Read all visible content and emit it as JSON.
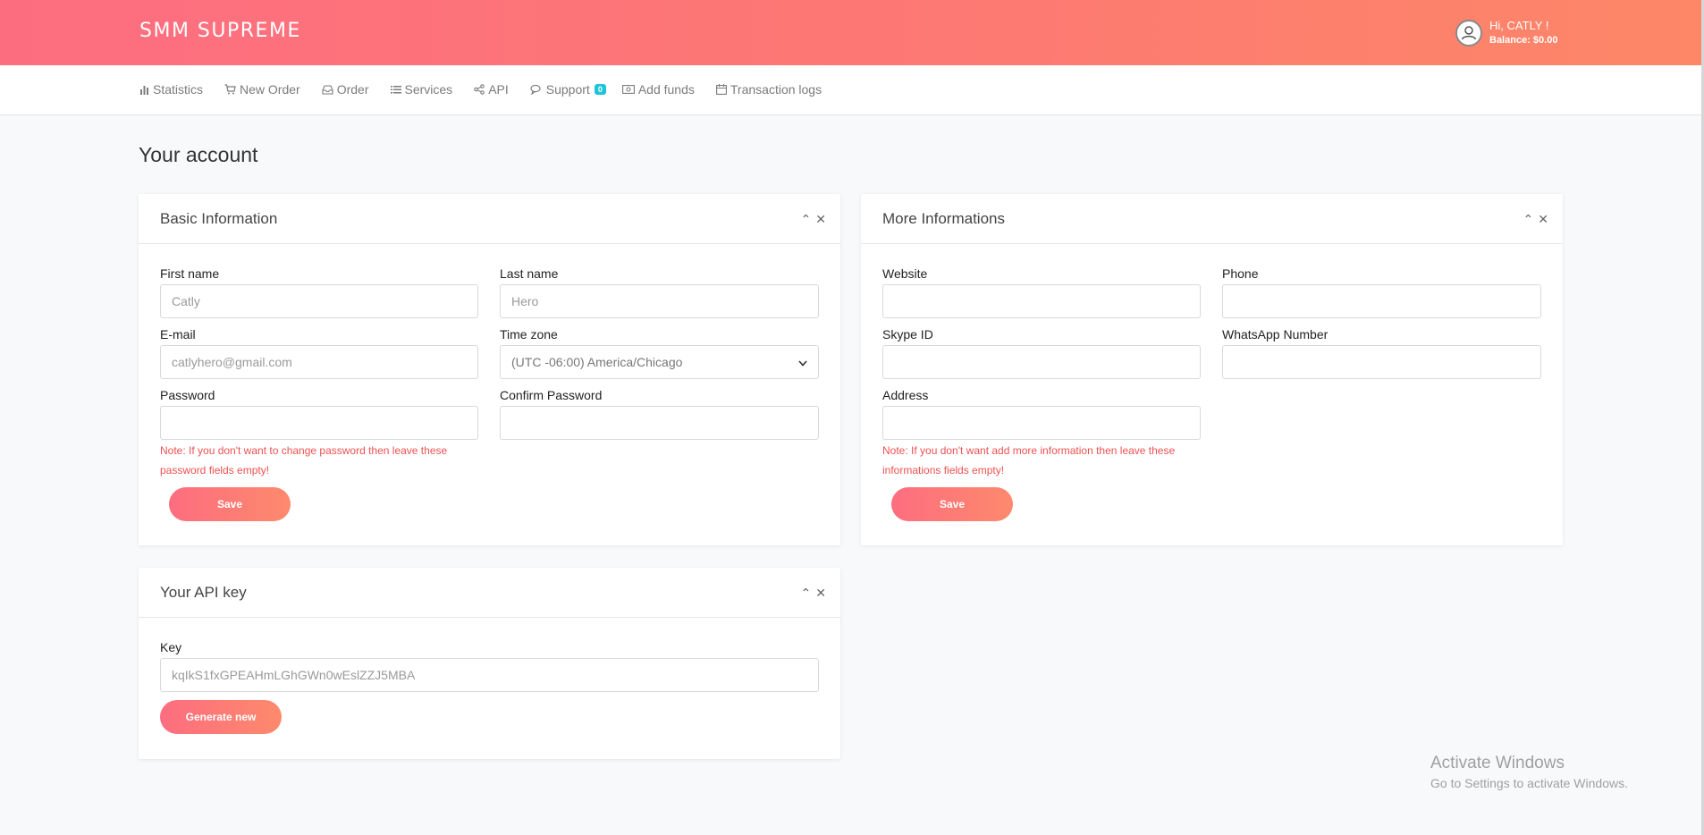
{
  "header": {
    "brand": "SMM SUPREME",
    "greeting": "Hi, CATLY !",
    "balance": "Balance: $0.00",
    "accent_start": "#fd6d80",
    "accent_end": "#fd8767"
  },
  "nav": {
    "items": [
      {
        "label": "Statistics",
        "icon": "bar-chart-icon"
      },
      {
        "label": "New Order",
        "icon": "cart-icon"
      },
      {
        "label": "Order",
        "icon": "inbox-icon"
      },
      {
        "label": "Services",
        "icon": "list-icon"
      },
      {
        "label": "API",
        "icon": "share-icon"
      },
      {
        "label": "Support",
        "icon": "chat-icon",
        "badge": "0"
      },
      {
        "label": "Add funds",
        "icon": "money-icon"
      },
      {
        "label": "Transaction logs",
        "icon": "calendar-icon"
      }
    ]
  },
  "page": {
    "title": "Your account"
  },
  "basic": {
    "title": "Basic Information",
    "first_name_label": "First name",
    "first_name_value": "Catly",
    "last_name_label": "Last name",
    "last_name_value": "Hero",
    "email_label": "E-mail",
    "email_value": "catlyhero@gmail.com",
    "timezone_label": "Time zone",
    "timezone_value": "(UTC -06:00) America/Chicago",
    "password_label": "Password",
    "confirm_label": "Confirm Password",
    "note_line1": "Note: If you don't want to change password then leave these",
    "note_line2": "password fields empty!",
    "save_label": "Save"
  },
  "more": {
    "title": "More Informations",
    "website_label": "Website",
    "phone_label": "Phone",
    "skype_label": "Skype ID",
    "whatsapp_label": "WhatsApp Number",
    "address_label": "Address",
    "note_line1": "Note: If you don't want add more information then leave these",
    "note_line2": "informations fields empty!",
    "save_label": "Save"
  },
  "api": {
    "title": "Your API key",
    "key_label": "Key",
    "key_value": "kqIkS1fxGPEAHmLGhGWn0wEslZZJ5MBA",
    "generate_label": "Generate new"
  },
  "watermark": {
    "line1": "Activate Windows",
    "line2": "Go to Settings to activate Windows."
  }
}
